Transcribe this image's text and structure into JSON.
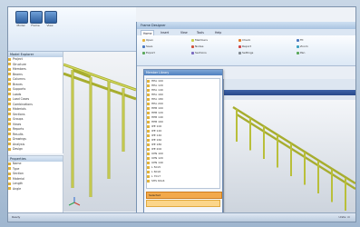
{
  "app": {
    "title": "Structural Modeling"
  },
  "left_ribbon": {
    "buttons": [
      "Model",
      "Frame",
      "View"
    ]
  },
  "tree": {
    "header": "Model Explorer",
    "items": [
      "Project",
      "Structure",
      "Members",
      "Beams",
      "Columns",
      "Braces",
      "Supports",
      "Loads",
      "Load Cases",
      "Combinations",
      "Materials",
      "Sections",
      "Groups",
      "Views",
      "Reports",
      "Results",
      "Drawings",
      "Analysis",
      "Design"
    ]
  },
  "props": {
    "header": "Properties",
    "rows": [
      "Name",
      "Type",
      "Section",
      "Material",
      "Length",
      "Angle"
    ]
  },
  "statusbar": {
    "left": "Ready",
    "right": "Units: m"
  },
  "second_window": {
    "title": "Frame Designer",
    "tabs": [
      "Home",
      "Insert",
      "View",
      "Tools",
      "Help"
    ],
    "ribbon": {
      "col1": [
        "Open",
        "Save",
        "Export"
      ],
      "col2": [
        "Members",
        "Nodes",
        "Sections"
      ],
      "col3": [
        "Check",
        "Report",
        "Settings"
      ],
      "col4": [
        "Fit",
        "Zoom",
        "Pan"
      ]
    },
    "dialog": {
      "title": "Member Library",
      "items": [
        "HEA 100",
        "HEA 120",
        "HEA 140",
        "HEA 160",
        "HEA 180",
        "HEA 200",
        "HEB 100",
        "HEB 120",
        "HEB 140",
        "HEB 160",
        "IPE 100",
        "IPE 120",
        "IPE 140",
        "IPE 160",
        "IPE 180",
        "IPE 200",
        "UPN 100",
        "UPN 120",
        "UPN 140",
        "L 50x5",
        "L 60x6",
        "L 70x7",
        "SHS 60x4"
      ],
      "selected": "Selected"
    }
  },
  "colors": {
    "accent": "#f2a94b",
    "beam": "#c9cf4a",
    "ribbon": "#dce8f5"
  }
}
